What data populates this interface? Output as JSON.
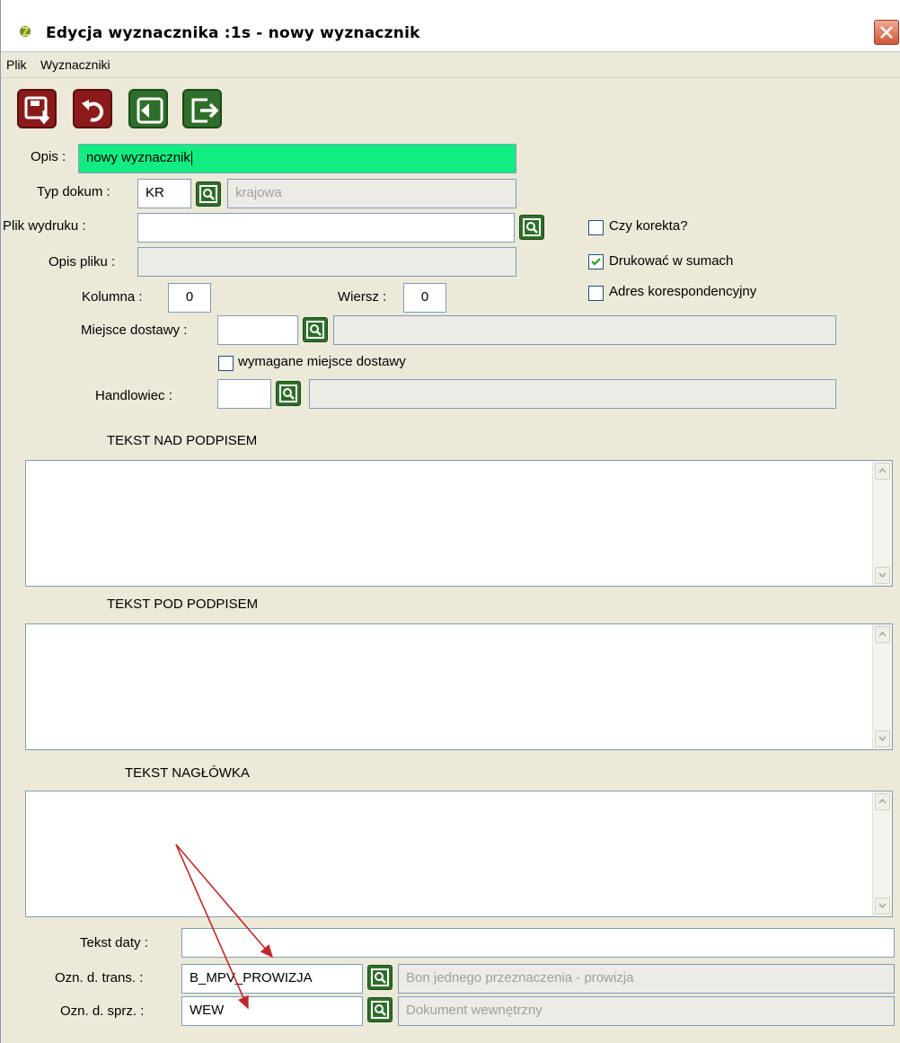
{
  "window": {
    "title": "Edycja wyznacznika :1s - nowy wyznacznik"
  },
  "menu": {
    "items": [
      "Plik",
      "Wyznaczniki"
    ]
  },
  "toolbar": {
    "buttons": [
      {
        "name": "save-icon",
        "color": "#8b1a1a"
      },
      {
        "name": "undo-icon",
        "color": "#8b1a1a"
      },
      {
        "name": "first-record-icon",
        "color": "#2f6e2a"
      },
      {
        "name": "exit-icon",
        "color": "#2f6e2a"
      }
    ]
  },
  "form": {
    "opis": {
      "label": "Opis :",
      "value": "nowy wyznacznik"
    },
    "typ_dokum": {
      "label": "Typ dokum :",
      "value": "KR",
      "description": "krajowa"
    },
    "plik_wydruku": {
      "label": "Plik wydruku :",
      "value": ""
    },
    "opis_pliku": {
      "label": "Opis pliku :",
      "value": ""
    },
    "kolumna": {
      "label": "Kolumna :",
      "value": "0"
    },
    "wiersz": {
      "label": "Wiersz :",
      "value": "0"
    },
    "miejsce_dostawy": {
      "label": "Miejsce dostawy :",
      "value": "",
      "description": ""
    },
    "wymagane_miejsce": {
      "label": "wymagane miejsce dostawy",
      "checked": false
    },
    "handlowiec": {
      "label": "Handlowiec :",
      "value": "",
      "description": ""
    },
    "checkboxes": {
      "czy_korekta": {
        "label": "Czy korekta?",
        "checked": false
      },
      "drukowac_w_sumach": {
        "label": "Drukować w sumach",
        "checked": true
      },
      "adres_koresp": {
        "label": "Adres korespondencyjny",
        "checked": false
      }
    },
    "tekst_nad_podpisem": {
      "label": "TEKST NAD PODPISEM",
      "value": ""
    },
    "tekst_pod_podpisem": {
      "label": "TEKST POD PODPISEM",
      "value": ""
    },
    "tekst_naglowka": {
      "label": "TEKST NAGŁÓWKA",
      "value": ""
    },
    "tekst_daty": {
      "label": "Tekst daty :",
      "value": ""
    },
    "ozn_d_trans": {
      "label": "Ozn. d. trans. :",
      "value": "B_MPV_PROWIZJA",
      "description": "Bon jednego przeznaczenia - prowizja"
    },
    "ozn_d_sprz": {
      "label": "Ozn. d. sprz. :",
      "value": "WEW",
      "description": "Dokument wewnętrzny"
    }
  },
  "colors": {
    "accent_green_field": "#12ed83",
    "annotation_arrow": "#c0282a"
  }
}
